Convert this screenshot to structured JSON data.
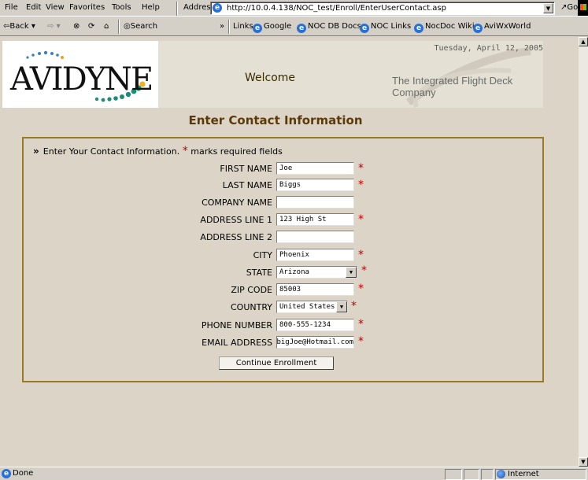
{
  "browser": {
    "menus": [
      "File",
      "Edit",
      "View",
      "Favorites",
      "Tools",
      "Help"
    ],
    "address_label": "Address",
    "url": "http://10.0.4.138/NOC_test/Enroll/EnterUserContact.asp",
    "go_label": "Go",
    "back_label": "Back",
    "search_label": "Search",
    "links_label": "Links",
    "links": [
      "Google",
      "NOC DB Docs",
      "NOC Links",
      "NocDoc Wiki",
      "AviWxWorld"
    ],
    "status": "Done",
    "zone": "Internet"
  },
  "header": {
    "logo_text": "AVIDYNE",
    "date": "Tuesday, April 12, 2005",
    "welcome": "Welcome",
    "tagline": "The Integrated Flight Deck Company"
  },
  "form": {
    "title": "Enter Contact Information",
    "intro_bullet": "»",
    "intro_prefix": "Enter Your Contact Information.",
    "intro_star": "*",
    "intro_suffix": "marks required fields",
    "fields": {
      "first_name": {
        "label": "FIRST NAME",
        "value": "Joe"
      },
      "last_name": {
        "label": "LAST NAME",
        "value": "Biggs"
      },
      "company": {
        "label": "COMPANY NAME",
        "value": ""
      },
      "address1": {
        "label": "ADDRESS LINE 1",
        "value": "123 High St"
      },
      "address2": {
        "label": "ADDRESS LINE 2",
        "value": ""
      },
      "city": {
        "label": "CITY",
        "value": "Phoenix"
      },
      "state": {
        "label": "STATE",
        "value": "Arizona"
      },
      "zip": {
        "label": "ZIP CODE",
        "value": "85003"
      },
      "country": {
        "label": "COUNTRY",
        "value": "United States"
      },
      "phone": {
        "label": "PHONE NUMBER",
        "value": "800-555-1234"
      },
      "email": {
        "label": "EMAIL ADDRESS",
        "value": "bigJoe@Hotmail.com"
      }
    },
    "required_star": "*",
    "submit_label": "Continue Enrollment"
  },
  "colors": {
    "title": "#5c3a08",
    "form_border": "#9a7a2a",
    "required": "#c00000",
    "page_bg": "#ddd4c8"
  }
}
